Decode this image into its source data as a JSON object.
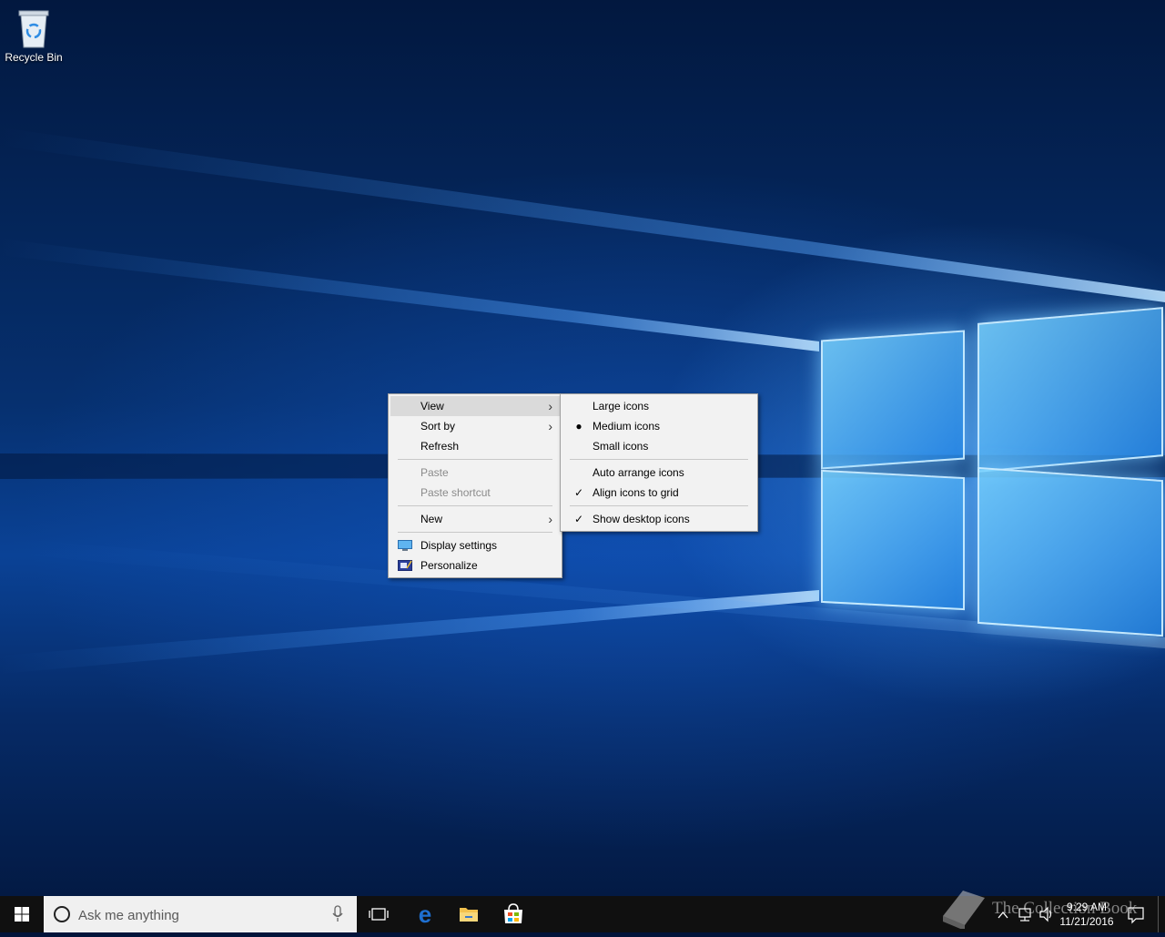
{
  "desktop": {
    "icons": [
      {
        "label": "Recycle Bin",
        "icon": "recycle-bin-icon"
      }
    ]
  },
  "context_menu": {
    "items": [
      {
        "label": "View",
        "submenu": true,
        "highlighted": true
      },
      {
        "label": "Sort by",
        "submenu": true
      },
      {
        "label": "Refresh"
      },
      {
        "label": "Paste",
        "disabled": true
      },
      {
        "label": "Paste shortcut",
        "disabled": true
      },
      {
        "label": "New",
        "submenu": true
      },
      {
        "label": "Display settings",
        "icon": "display-settings-icon"
      },
      {
        "label": "Personalize",
        "icon": "personalize-icon"
      }
    ]
  },
  "view_submenu": {
    "items": [
      {
        "label": "Large icons"
      },
      {
        "label": "Medium icons",
        "selected": true,
        "mark": "bullet"
      },
      {
        "label": "Small icons"
      },
      {
        "label": "Auto arrange icons"
      },
      {
        "label": "Align icons to grid",
        "checked": true,
        "mark": "check"
      },
      {
        "label": "Show desktop icons",
        "checked": true,
        "mark": "check"
      }
    ]
  },
  "taskbar": {
    "search_placeholder": "Ask me anything",
    "pinned": [
      "task-view-icon",
      "edge-icon",
      "file-explorer-icon",
      "store-icon"
    ],
    "clock": {
      "time": "9:29 AM",
      "date": "11/21/2016"
    },
    "watermark": "The Collection Book"
  },
  "colors": {
    "menu_bg": "#f2f2f2",
    "menu_hover": "#dadada",
    "taskbar": "#101010",
    "edge_blue": "#1e6fd0"
  }
}
